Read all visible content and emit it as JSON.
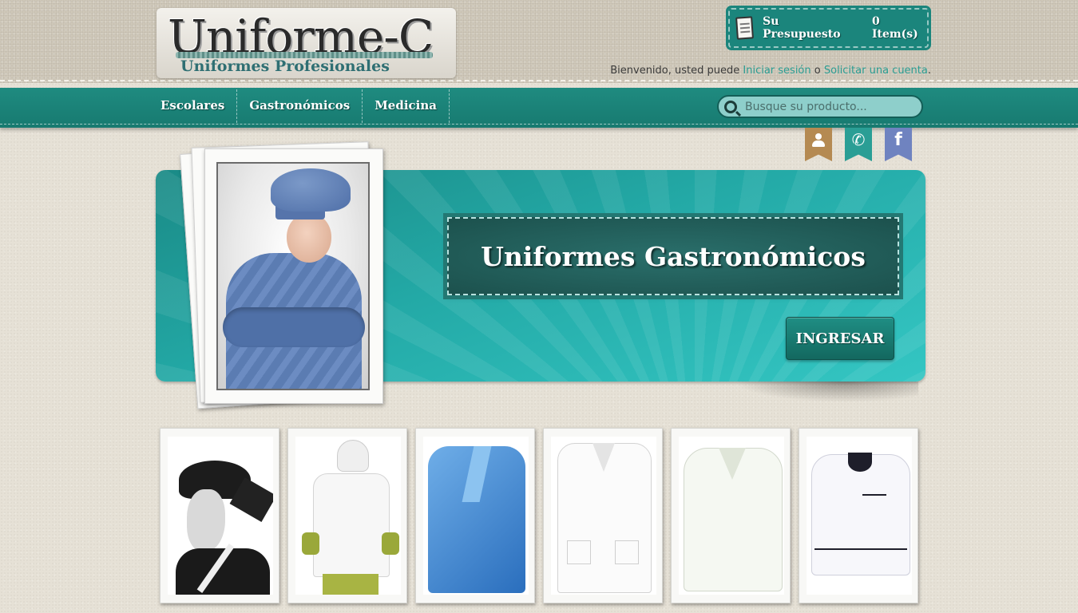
{
  "logo": {
    "title": "Uniforme-C",
    "subtitle": "Uniformes Profesionales"
  },
  "cart": {
    "label": "Su Presupuesto",
    "items": "0 Item(s)",
    "icon": "clipboard-icon"
  },
  "welcome": {
    "text_before": "Bienvenido, usted puede ",
    "login_link": "Iniciar sesión",
    "connector": " o ",
    "register_link": "Solicitar una cuenta",
    "text_after": "."
  },
  "nav": {
    "items": [
      {
        "label": "Escolares"
      },
      {
        "label": "Gastronómicos"
      },
      {
        "label": "Medicina"
      }
    ]
  },
  "search": {
    "placeholder": "Busque su producto...",
    "value": ""
  },
  "social": {
    "user_icon": "user-icon",
    "phone_icon": "phone-icon",
    "phone_glyph": "✆",
    "facebook_icon": "facebook-icon",
    "facebook_glyph": "f",
    "colors": {
      "user": "#b58a52",
      "phone": "#2a9e95",
      "facebook": "#6f83c0"
    }
  },
  "hero": {
    "title": "Uniformes Gastronómicos",
    "button": "INGRESAR"
  },
  "products": [
    {
      "name": "bandana-negra"
    },
    {
      "name": "chaqueta-chef-blanca"
    },
    {
      "name": "chaqueta-azul"
    },
    {
      "name": "delantal-blanco"
    },
    {
      "name": "casaca-blanca"
    },
    {
      "name": "chaqueta-blanca-ribete"
    }
  ],
  "colors": {
    "accent": "#1b857c",
    "link": "#2a9d93",
    "background": "#e6e1d6"
  }
}
